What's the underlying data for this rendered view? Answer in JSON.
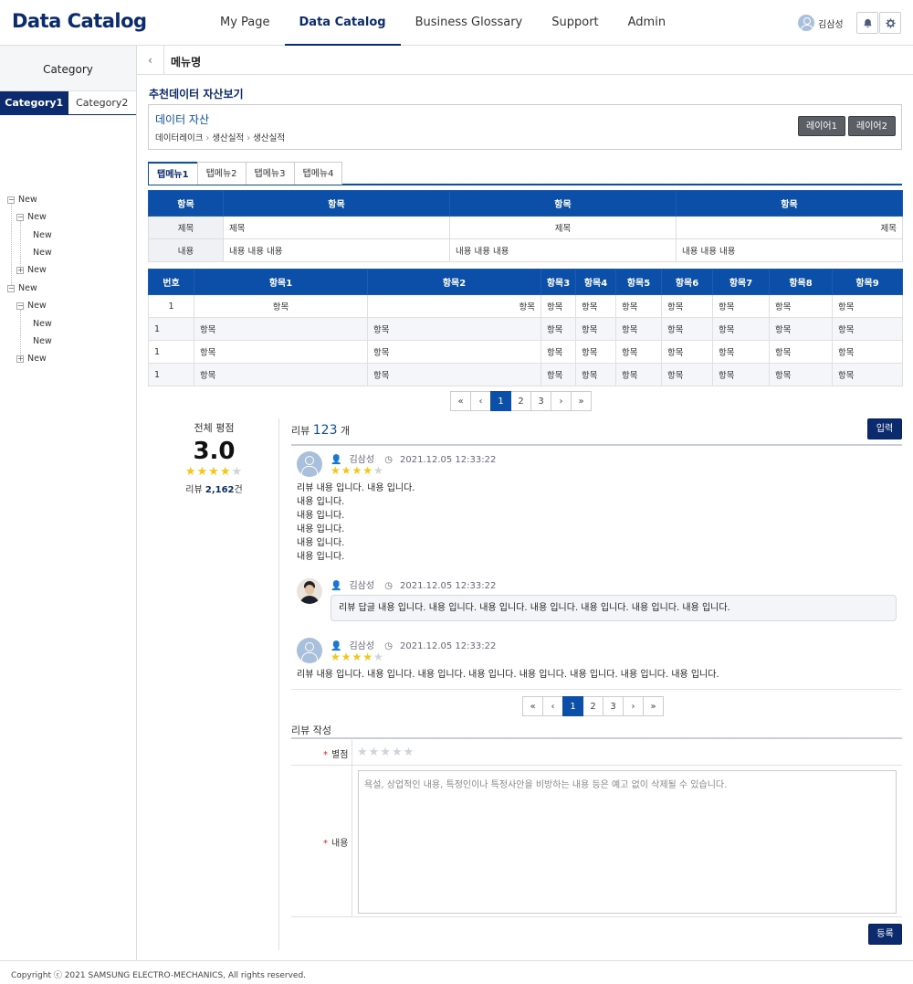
{
  "header": {
    "logo": "Data Catalog",
    "nav": [
      "My Page",
      "Data Catalog",
      "Business Glossary",
      "Support",
      "Admin"
    ],
    "active_nav": "Data Catalog",
    "user_name": "김삼성"
  },
  "sidebar": {
    "title": "Category",
    "tabs": [
      "Category1",
      "Category2"
    ],
    "tree": [
      {
        "label": "New",
        "toggle": "−"
      },
      {
        "label": "New",
        "toggle": "−"
      },
      {
        "label": "New"
      },
      {
        "label": "New"
      },
      {
        "label": "New",
        "toggle": "+"
      },
      {
        "label": "New",
        "toggle": "−"
      },
      {
        "label": "New",
        "toggle": "−"
      },
      {
        "label": "New"
      },
      {
        "label": "New"
      },
      {
        "label": "New",
        "toggle": "+"
      }
    ]
  },
  "main": {
    "back_icon": "‹",
    "menu_name": "메뉴명",
    "section_title": "추천데이터 자산보기",
    "asset": {
      "title": "데이터 자산",
      "path": [
        "데이터레이크",
        "생산실적",
        "생산실적"
      ],
      "buttons": [
        "레이어1",
        "레이어2"
      ]
    },
    "tabs": [
      "탭메뉴1",
      "탭메뉴2",
      "탭메뉴3",
      "탭메뉴4"
    ],
    "table1": {
      "headers": [
        "항목",
        "항목",
        "항목",
        "항목"
      ],
      "rows": [
        [
          "제목",
          "제목",
          "제목",
          "제목"
        ],
        [
          "내용",
          "내용 내용 내용",
          "내용 내용 내용",
          "내용 내용 내용"
        ]
      ]
    },
    "table2": {
      "headers": [
        "번호",
        "항목1",
        "항목2",
        "항목3",
        "항목4",
        "항목5",
        "항목6",
        "항목7",
        "항목8",
        "항목9"
      ],
      "rows": [
        [
          "1",
          "항목",
          "항목",
          "항목",
          "항목",
          "항목",
          "항목",
          "항목",
          "항목",
          "항목"
        ],
        [
          "1",
          "항목",
          "항목",
          "항목",
          "항목",
          "항목",
          "항목",
          "항목",
          "항목",
          "항목"
        ],
        [
          "1",
          "항목",
          "항목",
          "항목",
          "항목",
          "항목",
          "항목",
          "항목",
          "항목",
          "항목"
        ],
        [
          "1",
          "항목",
          "항목",
          "항목",
          "항목",
          "항목",
          "항목",
          "항목",
          "항목",
          "항목"
        ]
      ]
    },
    "pager": {
      "first": "«",
      "prev": "‹",
      "pages": [
        "1",
        "2",
        "3"
      ],
      "current": "1",
      "next": "›",
      "last": "»"
    },
    "rating": {
      "label": "전체 평점",
      "score": "3.0",
      "stars": 4,
      "count_prefix": "리뷰",
      "count": "2,162",
      "count_suffix": "건"
    },
    "reviews": {
      "title_prefix": "리뷰",
      "count": "123",
      "title_suffix": "개",
      "input_button": "입력",
      "items": [
        {
          "author": "김삼성",
          "date": "2021.12.05 12:33:22",
          "stars": 4,
          "text": [
            "리뷰 내용 입니다. 내용 입니다.",
            "내용 입니다.",
            "내용 입니다.",
            "내용 입니다.",
            "내용 입니다.",
            "내용 입니다."
          ]
        },
        {
          "author": "김삼성",
          "date": "2021.12.05 12:33:22",
          "reply": "리뷰 답글 내용 입니다. 내용 입니다. 내용 입니다. 내용 입니다. 내용 입니다. 내용 입니다. 내용 입니다."
        },
        {
          "author": "김삼성",
          "date": "2021.12.05 12:33:22",
          "stars": 4,
          "text": [
            "리뷰 내용 입니다. 내용 입니다. 내용 입니다. 내용 입니다. 내용 입니다. 내용 입니다. 내용 입니다. 내용 입니다."
          ]
        }
      ]
    },
    "write": {
      "title": "리뷰 작성",
      "star_label": "별점",
      "content_label": "내용",
      "placeholder": "욕설, 상업적인 내용, 특정인이나 특정사안을 비방하는 내용 등은 예고 없이 삭제될 수 있습니다.",
      "submit": "등록"
    }
  },
  "footer": {
    "copyright": "Copyright ⓒ 2021 SAMSUNG ELECTRO-MECHANICS, All rights reserved."
  },
  "colors": {
    "primary": "#0c2b6e",
    "table_header": "#0c4fa8",
    "star": "#f5c518"
  }
}
